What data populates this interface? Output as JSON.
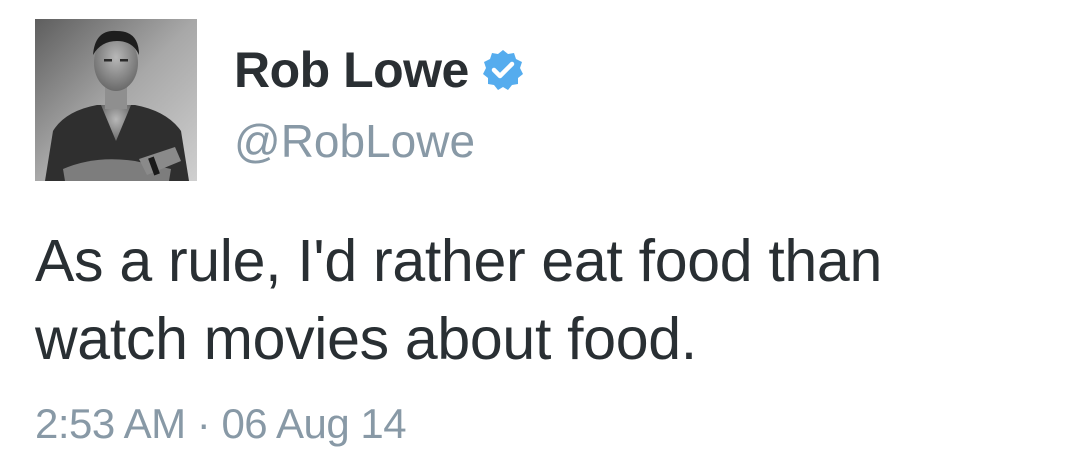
{
  "author": {
    "display_name": "Rob Lowe",
    "handle": "@RobLowe",
    "verified": true,
    "avatar_icon": "profile-photo",
    "verified_icon": "verified-badge-icon",
    "verified_color": "#55acee"
  },
  "tweet": {
    "text_lines": [
      "As a rule, I'd rather eat food than",
      "watch movies about food."
    ],
    "time": "2:53 AM",
    "separator": "·",
    "date": "06 Aug 14"
  },
  "colors": {
    "name": "#2a2f33",
    "text": "#292f33",
    "meta": "#8899a6"
  }
}
